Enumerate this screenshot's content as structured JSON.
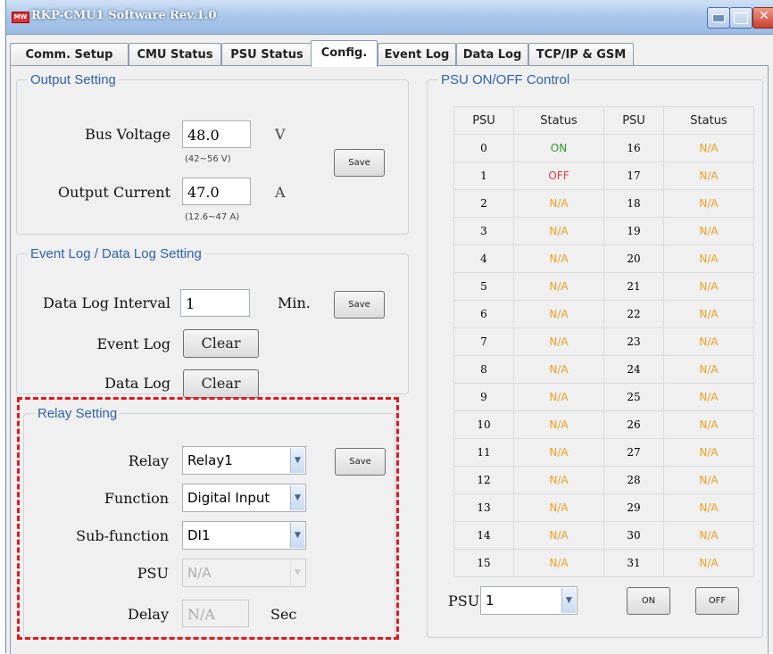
{
  "window": {
    "title": "RKP-CMU1 Software  Rev.1.0",
    "icon_text": "MW"
  },
  "tabs": [
    "Comm. Setup",
    "CMU Status",
    "PSU Status",
    "Config.",
    "Event Log",
    "Data Log",
    "TCP/IP & GSM"
  ],
  "active_tab": "Config.",
  "output_setting": {
    "title": "Output Setting",
    "bus_voltage_label": "Bus Voltage",
    "bus_voltage_value": "48.0",
    "bus_voltage_unit": "V",
    "bus_voltage_range": "(42~56 V)",
    "output_current_label": "Output Current",
    "output_current_value": "47.0",
    "output_current_unit": "A",
    "output_current_range": "(12.6~47 A)",
    "save_label": "Save"
  },
  "log_setting": {
    "title": "Event Log / Data Log Setting",
    "interval_label": "Data Log Interval",
    "interval_value": "1",
    "interval_unit": "Min.",
    "save_label": "Save",
    "event_log_label": "Event Log",
    "data_log_label": "Data Log",
    "clear_label": "Clear"
  },
  "relay_setting": {
    "title": "Relay Setting",
    "relay_label": "Relay",
    "relay_value": "Relay1",
    "function_label": "Function",
    "function_value": "Digital Input",
    "subfunction_label": "Sub-function",
    "subfunction_value": "DI1",
    "psu_label": "PSU",
    "psu_value": "N/A",
    "delay_label": "Delay",
    "delay_value": "N/A",
    "delay_unit": "Sec",
    "save_label": "Save"
  },
  "psu_control": {
    "title": "PSU ON/OFF Control",
    "headers": [
      "PSU",
      "Status",
      "PSU",
      "Status"
    ],
    "rows": [
      [
        "0",
        "ON",
        "16",
        "N/A"
      ],
      [
        "1",
        "OFF",
        "17",
        "N/A"
      ],
      [
        "2",
        "N/A",
        "18",
        "N/A"
      ],
      [
        "3",
        "N/A",
        "19",
        "N/A"
      ],
      [
        "4",
        "N/A",
        "20",
        "N/A"
      ],
      [
        "5",
        "N/A",
        "21",
        "N/A"
      ],
      [
        "6",
        "N/A",
        "22",
        "N/A"
      ],
      [
        "7",
        "N/A",
        "23",
        "N/A"
      ],
      [
        "8",
        "N/A",
        "24",
        "N/A"
      ],
      [
        "9",
        "N/A",
        "25",
        "N/A"
      ],
      [
        "10",
        "N/A",
        "26",
        "N/A"
      ],
      [
        "11",
        "N/A",
        "27",
        "N/A"
      ],
      [
        "12",
        "N/A",
        "28",
        "N/A"
      ],
      [
        "13",
        "N/A",
        "29",
        "N/A"
      ],
      [
        "14",
        "N/A",
        "30",
        "N/A"
      ],
      [
        "15",
        "N/A",
        "31",
        "N/A"
      ]
    ],
    "status_colors": {
      "ON": "#2e9e2e",
      "OFF": "#e03a3a",
      "N/A": "#f0a020"
    },
    "psu_select_label": "PSU",
    "psu_select_value": "1",
    "on_label": "ON",
    "off_label": "OFF"
  }
}
